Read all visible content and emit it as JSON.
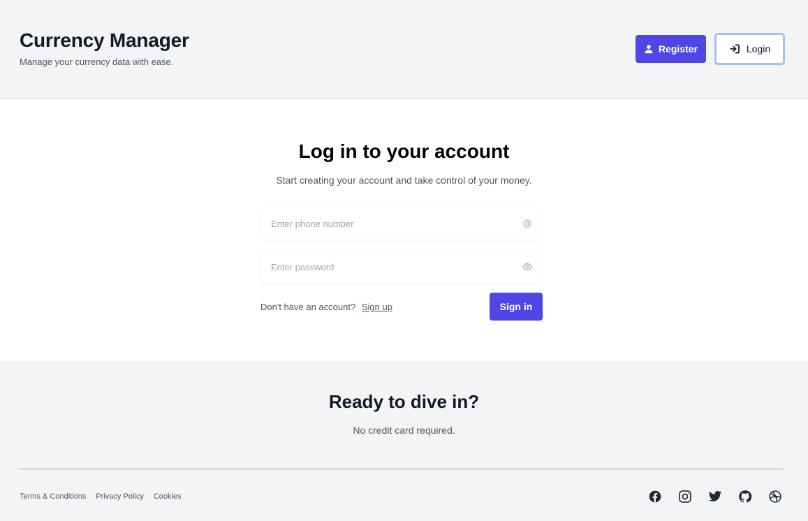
{
  "header": {
    "title": "Currency Manager",
    "subtitle": "Manage your currency data with ease.",
    "register_label": "Register",
    "login_label": "Login"
  },
  "login": {
    "title": "Log in to your account",
    "subtitle": "Start creating your account and take control of your money.",
    "phone_placeholder": "Enter phone number",
    "phone_value": "",
    "password_placeholder": "Enter password",
    "password_value": "",
    "no_account_text": "Don't have an account?",
    "signup_label": "Sign up",
    "signin_label": "Sign in",
    "at_symbol": "@"
  },
  "cta": {
    "title": "Ready to dive in?",
    "subtitle": "No credit card required."
  },
  "footer": {
    "links": [
      "Terms & Conditions",
      "Privacy Policy",
      "Cookies"
    ],
    "social_icons": [
      "facebook-icon",
      "instagram-icon",
      "twitter-icon",
      "github-icon",
      "dribbble-icon"
    ]
  },
  "colors": {
    "accent": "#4f46e5",
    "page_bg": "#f3f4f6",
    "card_bg": "#ffffff",
    "text_muted": "#4b5563"
  }
}
